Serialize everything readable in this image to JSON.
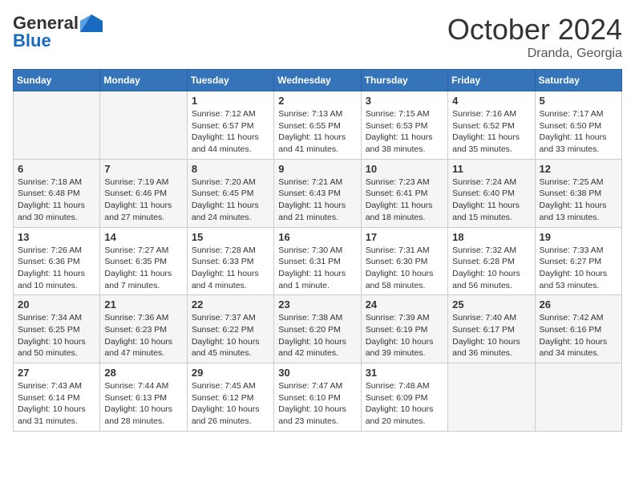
{
  "header": {
    "logo": {
      "general": "General",
      "blue": "Blue",
      "tagline": ""
    },
    "title": "October 2024",
    "location": "Dranda, Georgia"
  },
  "weekdays": [
    "Sunday",
    "Monday",
    "Tuesday",
    "Wednesday",
    "Thursday",
    "Friday",
    "Saturday"
  ],
  "weeks": [
    [
      {
        "day": null,
        "info": null
      },
      {
        "day": null,
        "info": null
      },
      {
        "day": "1",
        "info": "Sunrise: 7:12 AM\nSunset: 6:57 PM\nDaylight: 11 hours and 44 minutes."
      },
      {
        "day": "2",
        "info": "Sunrise: 7:13 AM\nSunset: 6:55 PM\nDaylight: 11 hours and 41 minutes."
      },
      {
        "day": "3",
        "info": "Sunrise: 7:15 AM\nSunset: 6:53 PM\nDaylight: 11 hours and 38 minutes."
      },
      {
        "day": "4",
        "info": "Sunrise: 7:16 AM\nSunset: 6:52 PM\nDaylight: 11 hours and 35 minutes."
      },
      {
        "day": "5",
        "info": "Sunrise: 7:17 AM\nSunset: 6:50 PM\nDaylight: 11 hours and 33 minutes."
      }
    ],
    [
      {
        "day": "6",
        "info": "Sunrise: 7:18 AM\nSunset: 6:48 PM\nDaylight: 11 hours and 30 minutes."
      },
      {
        "day": "7",
        "info": "Sunrise: 7:19 AM\nSunset: 6:46 PM\nDaylight: 11 hours and 27 minutes."
      },
      {
        "day": "8",
        "info": "Sunrise: 7:20 AM\nSunset: 6:45 PM\nDaylight: 11 hours and 24 minutes."
      },
      {
        "day": "9",
        "info": "Sunrise: 7:21 AM\nSunset: 6:43 PM\nDaylight: 11 hours and 21 minutes."
      },
      {
        "day": "10",
        "info": "Sunrise: 7:23 AM\nSunset: 6:41 PM\nDaylight: 11 hours and 18 minutes."
      },
      {
        "day": "11",
        "info": "Sunrise: 7:24 AM\nSunset: 6:40 PM\nDaylight: 11 hours and 15 minutes."
      },
      {
        "day": "12",
        "info": "Sunrise: 7:25 AM\nSunset: 6:38 PM\nDaylight: 11 hours and 13 minutes."
      }
    ],
    [
      {
        "day": "13",
        "info": "Sunrise: 7:26 AM\nSunset: 6:36 PM\nDaylight: 11 hours and 10 minutes."
      },
      {
        "day": "14",
        "info": "Sunrise: 7:27 AM\nSunset: 6:35 PM\nDaylight: 11 hours and 7 minutes."
      },
      {
        "day": "15",
        "info": "Sunrise: 7:28 AM\nSunset: 6:33 PM\nDaylight: 11 hours and 4 minutes."
      },
      {
        "day": "16",
        "info": "Sunrise: 7:30 AM\nSunset: 6:31 PM\nDaylight: 11 hours and 1 minute."
      },
      {
        "day": "17",
        "info": "Sunrise: 7:31 AM\nSunset: 6:30 PM\nDaylight: 10 hours and 58 minutes."
      },
      {
        "day": "18",
        "info": "Sunrise: 7:32 AM\nSunset: 6:28 PM\nDaylight: 10 hours and 56 minutes."
      },
      {
        "day": "19",
        "info": "Sunrise: 7:33 AM\nSunset: 6:27 PM\nDaylight: 10 hours and 53 minutes."
      }
    ],
    [
      {
        "day": "20",
        "info": "Sunrise: 7:34 AM\nSunset: 6:25 PM\nDaylight: 10 hours and 50 minutes."
      },
      {
        "day": "21",
        "info": "Sunrise: 7:36 AM\nSunset: 6:23 PM\nDaylight: 10 hours and 47 minutes."
      },
      {
        "day": "22",
        "info": "Sunrise: 7:37 AM\nSunset: 6:22 PM\nDaylight: 10 hours and 45 minutes."
      },
      {
        "day": "23",
        "info": "Sunrise: 7:38 AM\nSunset: 6:20 PM\nDaylight: 10 hours and 42 minutes."
      },
      {
        "day": "24",
        "info": "Sunrise: 7:39 AM\nSunset: 6:19 PM\nDaylight: 10 hours and 39 minutes."
      },
      {
        "day": "25",
        "info": "Sunrise: 7:40 AM\nSunset: 6:17 PM\nDaylight: 10 hours and 36 minutes."
      },
      {
        "day": "26",
        "info": "Sunrise: 7:42 AM\nSunset: 6:16 PM\nDaylight: 10 hours and 34 minutes."
      }
    ],
    [
      {
        "day": "27",
        "info": "Sunrise: 7:43 AM\nSunset: 6:14 PM\nDaylight: 10 hours and 31 minutes."
      },
      {
        "day": "28",
        "info": "Sunrise: 7:44 AM\nSunset: 6:13 PM\nDaylight: 10 hours and 28 minutes."
      },
      {
        "day": "29",
        "info": "Sunrise: 7:45 AM\nSunset: 6:12 PM\nDaylight: 10 hours and 26 minutes."
      },
      {
        "day": "30",
        "info": "Sunrise: 7:47 AM\nSunset: 6:10 PM\nDaylight: 10 hours and 23 minutes."
      },
      {
        "day": "31",
        "info": "Sunrise: 7:48 AM\nSunset: 6:09 PM\nDaylight: 10 hours and 20 minutes."
      },
      {
        "day": null,
        "info": null
      },
      {
        "day": null,
        "info": null
      }
    ]
  ]
}
